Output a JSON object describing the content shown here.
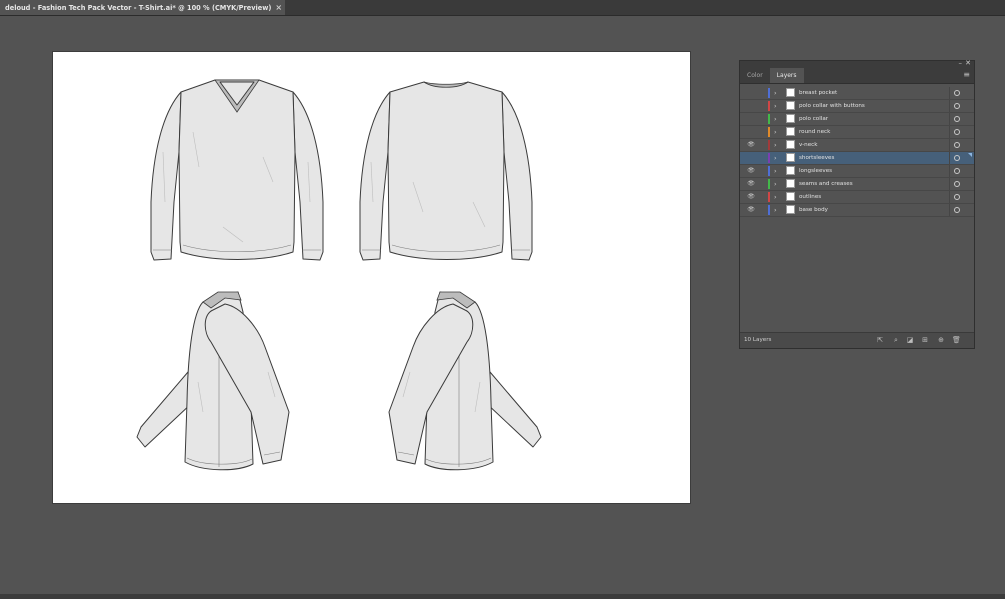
{
  "document_tab": {
    "title": "deloud - Fashion Tech Pack Vector - T-Shirt.ai* @ 100 % (CMYK/Preview)",
    "close_glyph": "×"
  },
  "panel": {
    "tabs": [
      "Color",
      "Layers"
    ],
    "active_tab": "Layers",
    "footer_count": "10 Layers",
    "layers": [
      {
        "name": "breast pocket",
        "color": "#4f6fd6",
        "visible": false,
        "selected": false
      },
      {
        "name": "polo collar with buttons",
        "color": "#d04646",
        "visible": false,
        "selected": false
      },
      {
        "name": "polo collar",
        "color": "#43b84a",
        "visible": false,
        "selected": false
      },
      {
        "name": "round neck",
        "color": "#e08a2a",
        "visible": false,
        "selected": false
      },
      {
        "name": "v-neck",
        "color": "#a23a3a",
        "visible": true,
        "selected": false
      },
      {
        "name": "shortsleeves",
        "color": "#7a3fb0",
        "visible": false,
        "selected": true
      },
      {
        "name": "longsleeves",
        "color": "#4f6fd6",
        "visible": true,
        "selected": false
      },
      {
        "name": "seams and creases",
        "color": "#43b84a",
        "visible": true,
        "selected": false
      },
      {
        "name": "outlines",
        "color": "#d04646",
        "visible": true,
        "selected": false
      },
      {
        "name": "base body",
        "color": "#4f6fd6",
        "visible": true,
        "selected": false
      }
    ]
  },
  "icons": {
    "eye": "eye-icon",
    "chevron": "chevron-right-icon",
    "target": "target-circle-icon",
    "panel_menu": "hamburger-menu-icon",
    "close": "close-icon",
    "minimize": "minimize-icon"
  },
  "colors": {
    "canvas": "#535353",
    "artboard": "#ffffff",
    "selected_row": "#46607a",
    "garment_fill": "#e6e6e6",
    "garment_stroke": "#3a3a3a"
  }
}
